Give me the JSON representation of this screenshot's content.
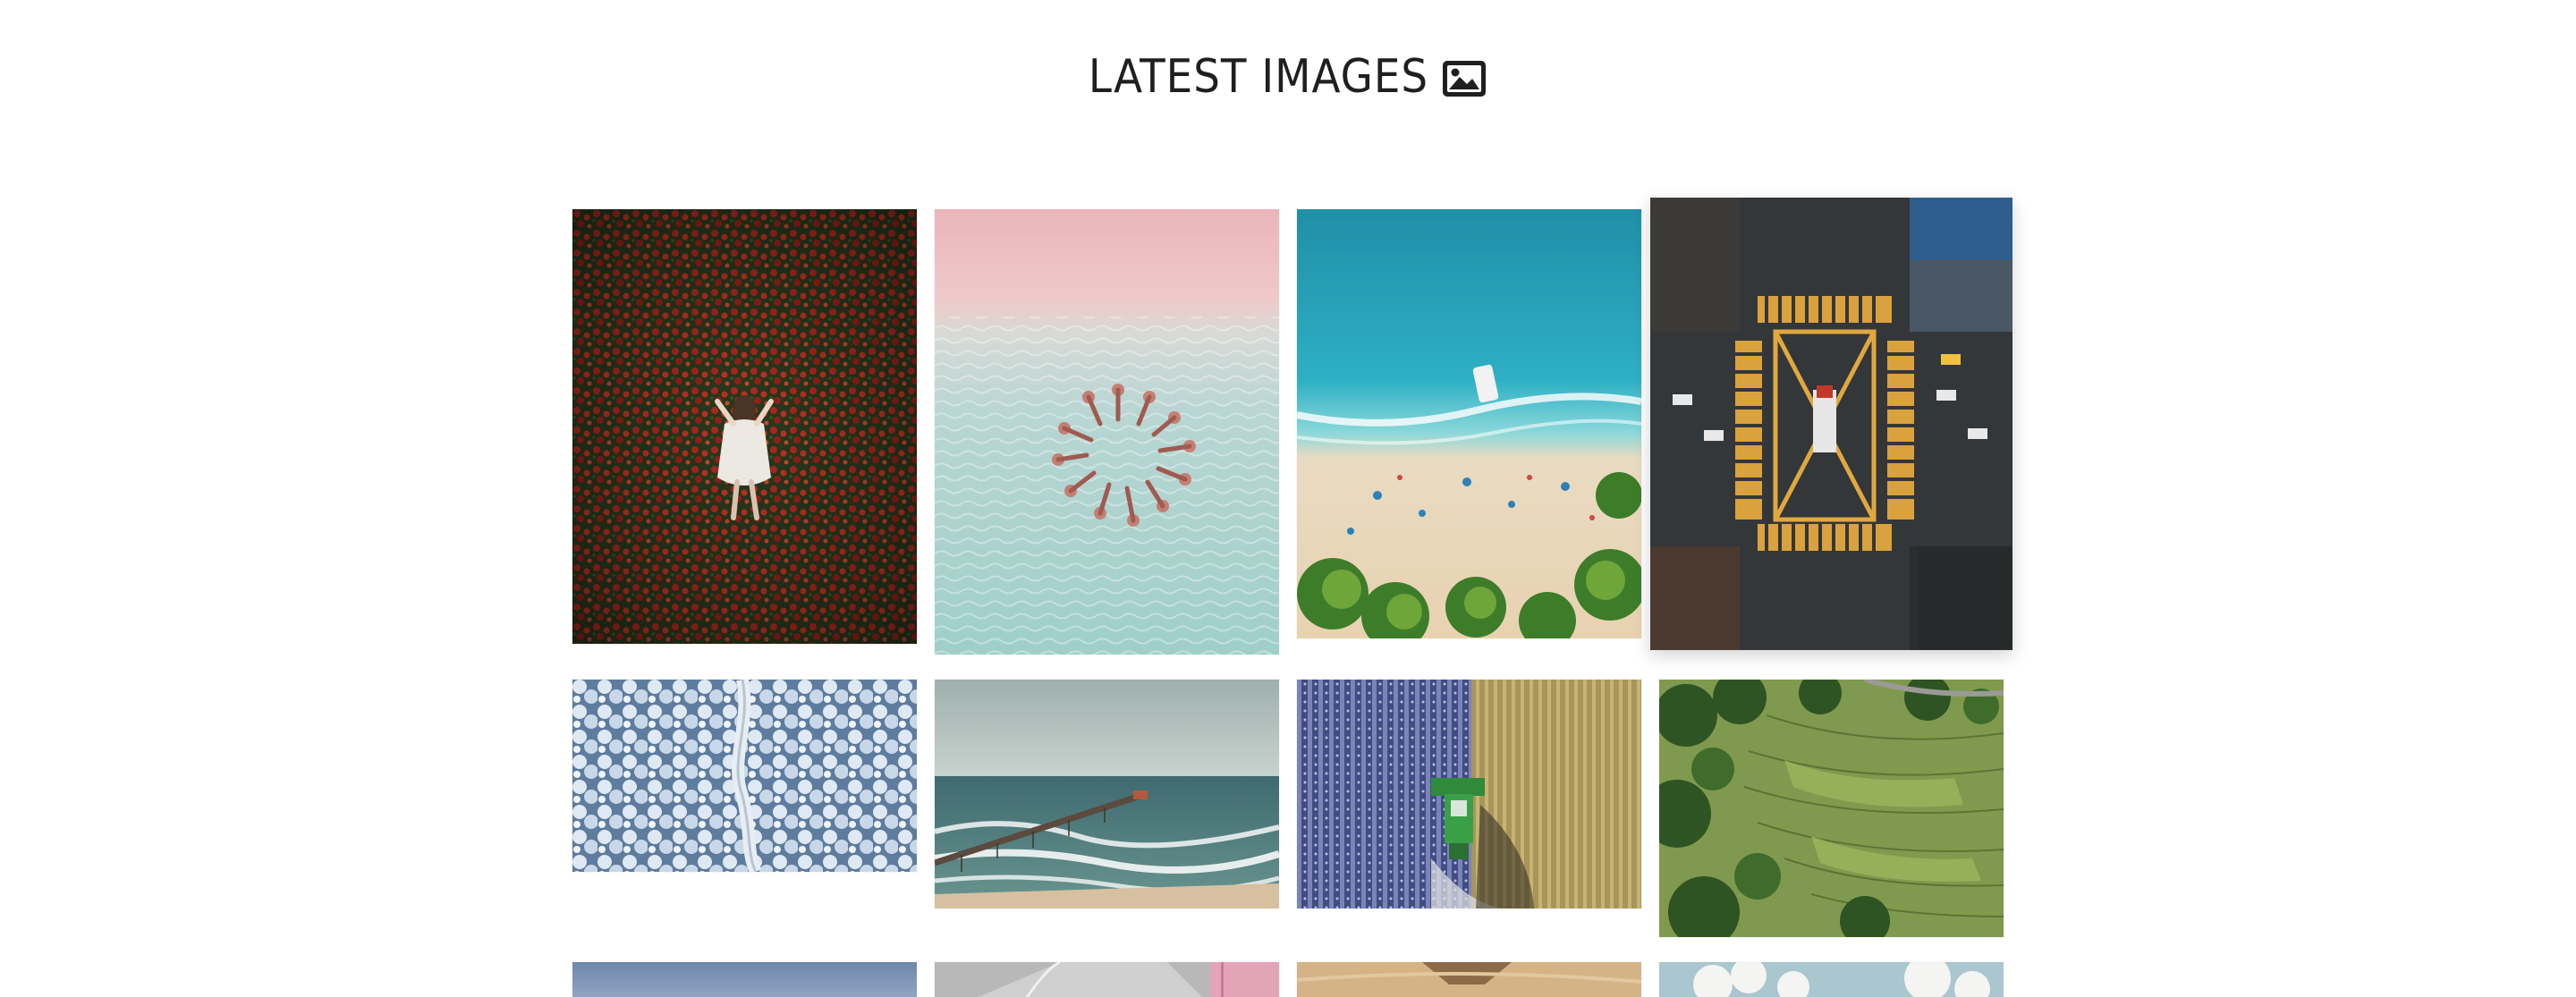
{
  "header": {
    "title": "LATEST IMAGES",
    "icon": "image-icon"
  },
  "colors": {
    "background": "#ffffff",
    "title": "#1f1f1f"
  },
  "gallery": {
    "images": [
      {
        "name": "poppy-field-woman-photo"
      },
      {
        "name": "pink-beach-circle-photo"
      },
      {
        "name": "tropical-beach-aerial-photo"
      },
      {
        "name": "city-intersection-aerial-photo"
      },
      {
        "name": "snowy-forest-road-photo"
      },
      {
        "name": "pier-ocean-photo"
      },
      {
        "name": "harvester-field-photo"
      },
      {
        "name": "rice-terraces-photo"
      },
      {
        "name": "sky-landscape-photo"
      },
      {
        "name": "abstract-grey-pink-photo"
      },
      {
        "name": "desert-sand-photo"
      },
      {
        "name": "coast-clouds-photo"
      }
    ]
  }
}
